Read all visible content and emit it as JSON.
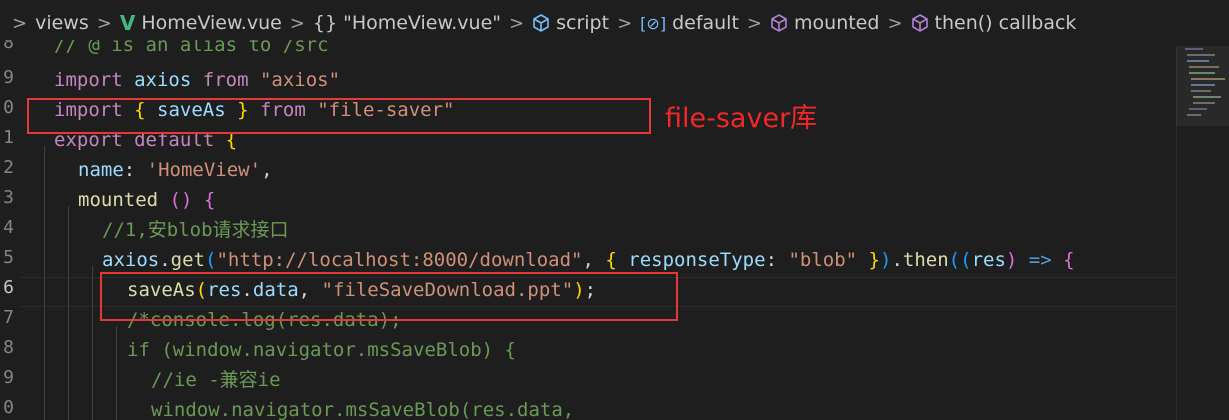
{
  "breadcrumb": {
    "items": [
      {
        "label": "views",
        "icon": "none"
      },
      {
        "label": "HomeView.vue",
        "icon": "vue-logo-icon"
      },
      {
        "label": "\"HomeView.vue\"",
        "icon": "braces-icon"
      },
      {
        "label": "script",
        "icon": "cube-icon"
      },
      {
        "label": "default",
        "icon": "brackets-icon"
      },
      {
        "label": "mounted",
        "icon": "cube-icon"
      },
      {
        "label": "then() callback",
        "icon": "cube-icon"
      }
    ],
    "separator": ">",
    "vue_glyph": "V",
    "brace_glyph": "{}",
    "bracket_glyph": "[⊘]"
  },
  "editor": {
    "gutter": [
      "8",
      "9",
      "0",
      "1",
      "2",
      "3",
      "4",
      "5",
      "6",
      "7",
      "8",
      "9",
      "0"
    ],
    "line1": {
      "text": "// @ is an alias to /src"
    },
    "line2": {
      "t1": "import",
      "t2": "axios",
      "t3": "from",
      "t4": "\"axios\""
    },
    "line3": {
      "t1": "import",
      "t2": "{",
      "t3": "saveAs",
      "t4": "}",
      "t5": "from",
      "t6": "\"file-saver\""
    },
    "line4": {
      "t1": "export",
      "t2": "default",
      "t3": "{"
    },
    "line5": {
      "t1": "name",
      "t2": ":",
      "t3": "'HomeView'",
      "t4": ","
    },
    "line6": {
      "t1": "mounted",
      "t2": "()",
      "t3": "{"
    },
    "line7": {
      "text": "//1,安blob请求接口"
    },
    "line8": {
      "t1": "axios",
      "t2": ".",
      "t3": "get",
      "t4": "(",
      "t5": "\"http://localhost:8000/download\"",
      "t6": ", ",
      "t7": "{",
      "t8": "responseType",
      "t9": ": ",
      "t10": "\"blob\"",
      "t11": "}",
      "t12": ")",
      "t13": ".",
      "t14": "then",
      "t15": "((",
      "t16": "res",
      "t17": ")",
      "t18": "=>",
      "t19": "{"
    },
    "line9": {
      "t1": "saveAs",
      "t2": "(",
      "t3": "res",
      "t4": ".",
      "t5": "data",
      "t6": ", ",
      "t7": "\"fileSaveDownload.ppt\"",
      "t8": ")",
      "t9": ";"
    },
    "line10": {
      "text": "/*console.log(res.data);"
    },
    "line11": {
      "t1": "if",
      "t2": "(window.navigator.msSaveBlob)",
      "t3": "{"
    },
    "line12": {
      "text": "//ie -兼容ie"
    },
    "line13": {
      "text": "window.navigator.msSaveBlob(res.data,"
    }
  },
  "annotation": {
    "label": "file-saver库"
  },
  "colors": {
    "keyword": "#c586c0",
    "variable": "#9cdcfe",
    "string": "#ce9178",
    "function": "#dcdcaa",
    "comment": "#6a9955",
    "annotation": "#f02828"
  }
}
